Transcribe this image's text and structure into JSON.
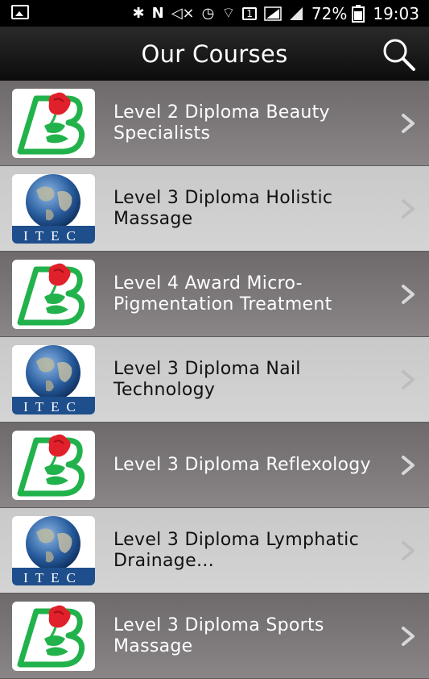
{
  "status_bar": {
    "battery_percent": "72%",
    "time": "19:03",
    "icons": [
      "gallery-icon",
      "bluetooth-icon",
      "nfc-icon",
      "mute-icon",
      "alarm-icon",
      "wifi-icon",
      "sim1-icon",
      "signal-icon",
      "signal2-icon",
      "battery-icon"
    ]
  },
  "header": {
    "title": "Our Courses",
    "search_icon": "search-icon"
  },
  "courses": [
    {
      "label": "Level 2 Diploma Beauty Specialists",
      "logo": "rose-b-logo",
      "style": "dark"
    },
    {
      "label": "Level 3 Diploma Holistic Massage",
      "logo": "itec-globe-logo",
      "style": "light"
    },
    {
      "label": "Level 4 Award Micro-Pigmentation Treatment",
      "logo": "rose-b-logo",
      "style": "dark"
    },
    {
      "label": "Level 3 Diploma Nail Technology",
      "logo": "itec-globe-logo",
      "style": "light"
    },
    {
      "label": "Level 3 Diploma Reflexology",
      "logo": "rose-b-logo",
      "style": "dark"
    },
    {
      "label": "Level 3 Diploma Lymphatic Drainage…",
      "logo": "itec-globe-logo",
      "style": "light"
    },
    {
      "label": "Level 3 Diploma Sports Massage",
      "logo": "rose-b-logo",
      "style": "dark"
    }
  ],
  "logo_text": {
    "itec": "ITEC"
  },
  "colors": {
    "dark_row": "#7a7678",
    "light_row": "#cfcfcf",
    "appbar": "#141414",
    "rose_red": "#e0202a",
    "leaf_green": "#22b24c",
    "globe_blue": "#1e4f8c"
  }
}
